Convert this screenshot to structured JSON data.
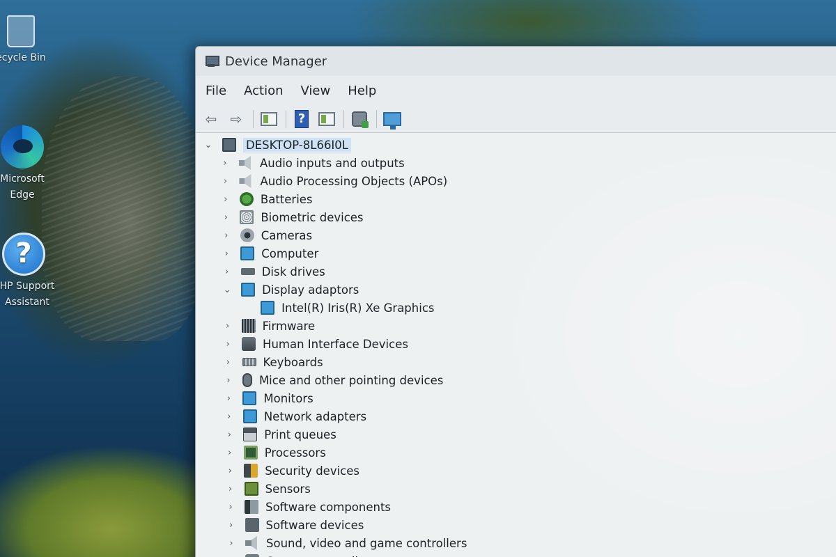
{
  "desktop": {
    "icons": [
      {
        "label": "ecycle Bin"
      },
      {
        "label": "Microsoft Edge"
      },
      {
        "label": "HP Support Assistant"
      }
    ]
  },
  "window": {
    "title": "Device Manager",
    "menu": [
      "File",
      "Action",
      "View",
      "Help"
    ],
    "toolbar": {
      "back": "back-arrow-icon",
      "forward": "forward-arrow-icon"
    },
    "tree": {
      "root": "DESKTOP-8L66I0L",
      "items": [
        {
          "label": "Audio inputs and outputs",
          "icon": "audio",
          "expanded": false
        },
        {
          "label": "Audio Processing Objects (APOs)",
          "icon": "audio",
          "expanded": false
        },
        {
          "label": "Batteries",
          "icon": "battery",
          "expanded": false
        },
        {
          "label": "Biometric devices",
          "icon": "bio",
          "expanded": false
        },
        {
          "label": "Cameras",
          "icon": "camera",
          "expanded": false
        },
        {
          "label": "Computer",
          "icon": "computer",
          "expanded": false
        },
        {
          "label": "Disk drives",
          "icon": "disk",
          "expanded": false
        },
        {
          "label": "Display adaptors",
          "icon": "display",
          "expanded": true,
          "children": [
            {
              "label": "Intel(R) Iris(R) Xe Graphics",
              "icon": "display"
            }
          ]
        },
        {
          "label": "Firmware",
          "icon": "firmware",
          "expanded": false
        },
        {
          "label": "Human Interface Devices",
          "icon": "hid",
          "expanded": false
        },
        {
          "label": "Keyboards",
          "icon": "keyboard",
          "expanded": false
        },
        {
          "label": "Mice and other pointing devices",
          "icon": "mouse",
          "expanded": false
        },
        {
          "label": "Monitors",
          "icon": "monitor",
          "expanded": false
        },
        {
          "label": "Network adapters",
          "icon": "network",
          "expanded": false
        },
        {
          "label": "Print queues",
          "icon": "print",
          "expanded": false
        },
        {
          "label": "Processors",
          "icon": "proc",
          "expanded": false
        },
        {
          "label": "Security devices",
          "icon": "security",
          "expanded": false
        },
        {
          "label": "Sensors",
          "icon": "sensor",
          "expanded": false
        },
        {
          "label": "Software components",
          "icon": "swcomp",
          "expanded": false
        },
        {
          "label": "Software devices",
          "icon": "swdev",
          "expanded": false
        },
        {
          "label": "Sound, video and game controllers",
          "icon": "sound",
          "expanded": false
        },
        {
          "label": "Storage controllers",
          "icon": "storage",
          "expanded": false
        }
      ]
    }
  }
}
